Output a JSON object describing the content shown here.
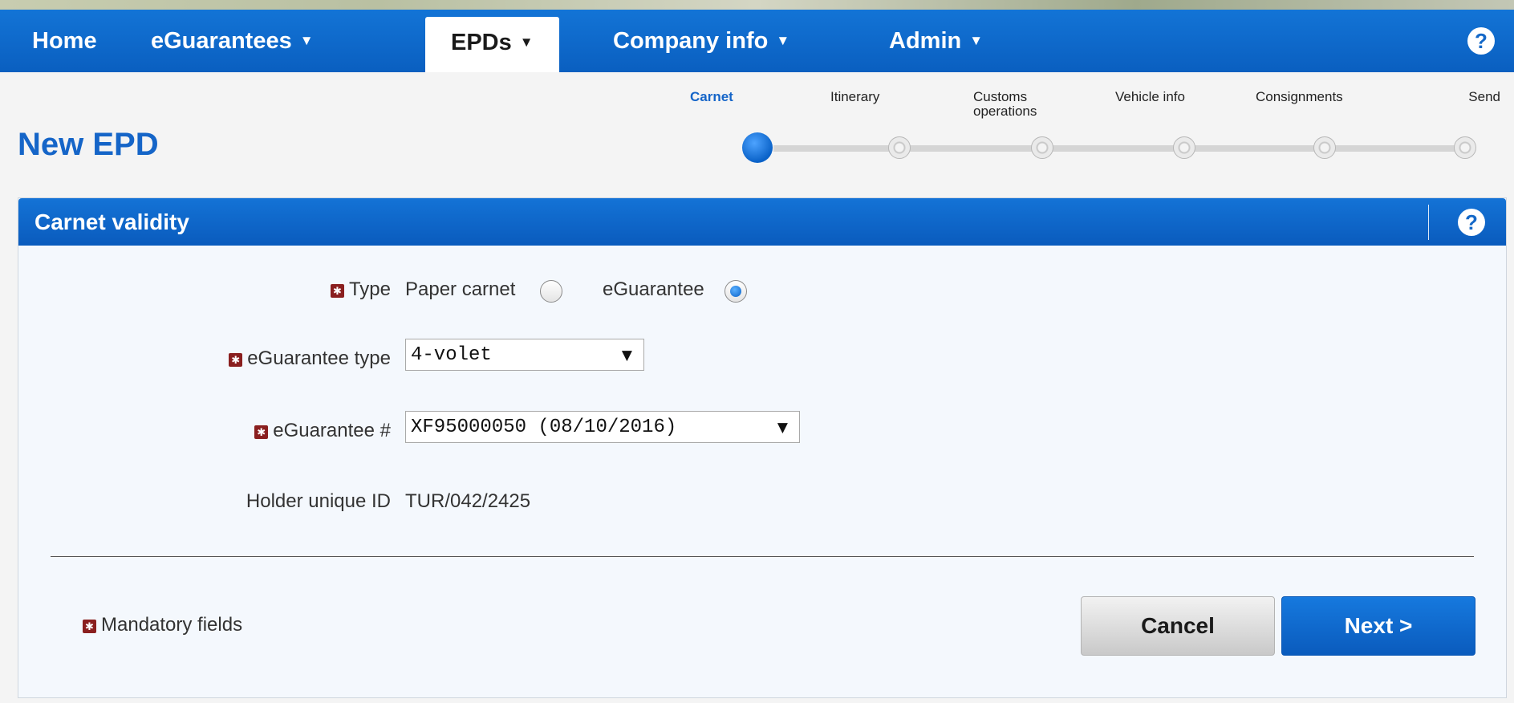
{
  "nav": {
    "items": [
      {
        "label": "Home",
        "has_caret": false
      },
      {
        "label": "eGuarantees",
        "has_caret": true
      },
      {
        "label": "EPDs",
        "has_caret": true,
        "active": true
      },
      {
        "label": "Company info",
        "has_caret": true
      },
      {
        "label": "Admin",
        "has_caret": true
      }
    ],
    "caret_icon": "▼",
    "help_label": "?"
  },
  "page": {
    "title": "New EPD"
  },
  "wizard": {
    "steps": [
      {
        "label": "Carnet",
        "current": true
      },
      {
        "label": "Itinerary"
      },
      {
        "label": "Customs operations"
      },
      {
        "label": "Vehicle info"
      },
      {
        "label": "Consignments"
      },
      {
        "label": "Send"
      }
    ]
  },
  "panel": {
    "title": "Carnet validity",
    "help_label": "?"
  },
  "form": {
    "type_label": "Type",
    "type_options": [
      {
        "label": "Paper carnet",
        "checked": false
      },
      {
        "label": "eGuarantee",
        "checked": true
      }
    ],
    "eguarantee_type_label": "eGuarantee type",
    "eguarantee_type_value": "4-volet",
    "eguarantee_number_label": "eGuarantee #",
    "eguarantee_number_value": "XF95000050 (08/10/2016)",
    "holder_id_label": "Holder unique ID",
    "holder_id_value": "TUR/042/2425",
    "mandatory_note": "Mandatory fields"
  },
  "buttons": {
    "cancel": "Cancel",
    "next": "Next >"
  },
  "colors": {
    "primary": "#0a62c8",
    "mandatory": "#8a1f1f"
  }
}
